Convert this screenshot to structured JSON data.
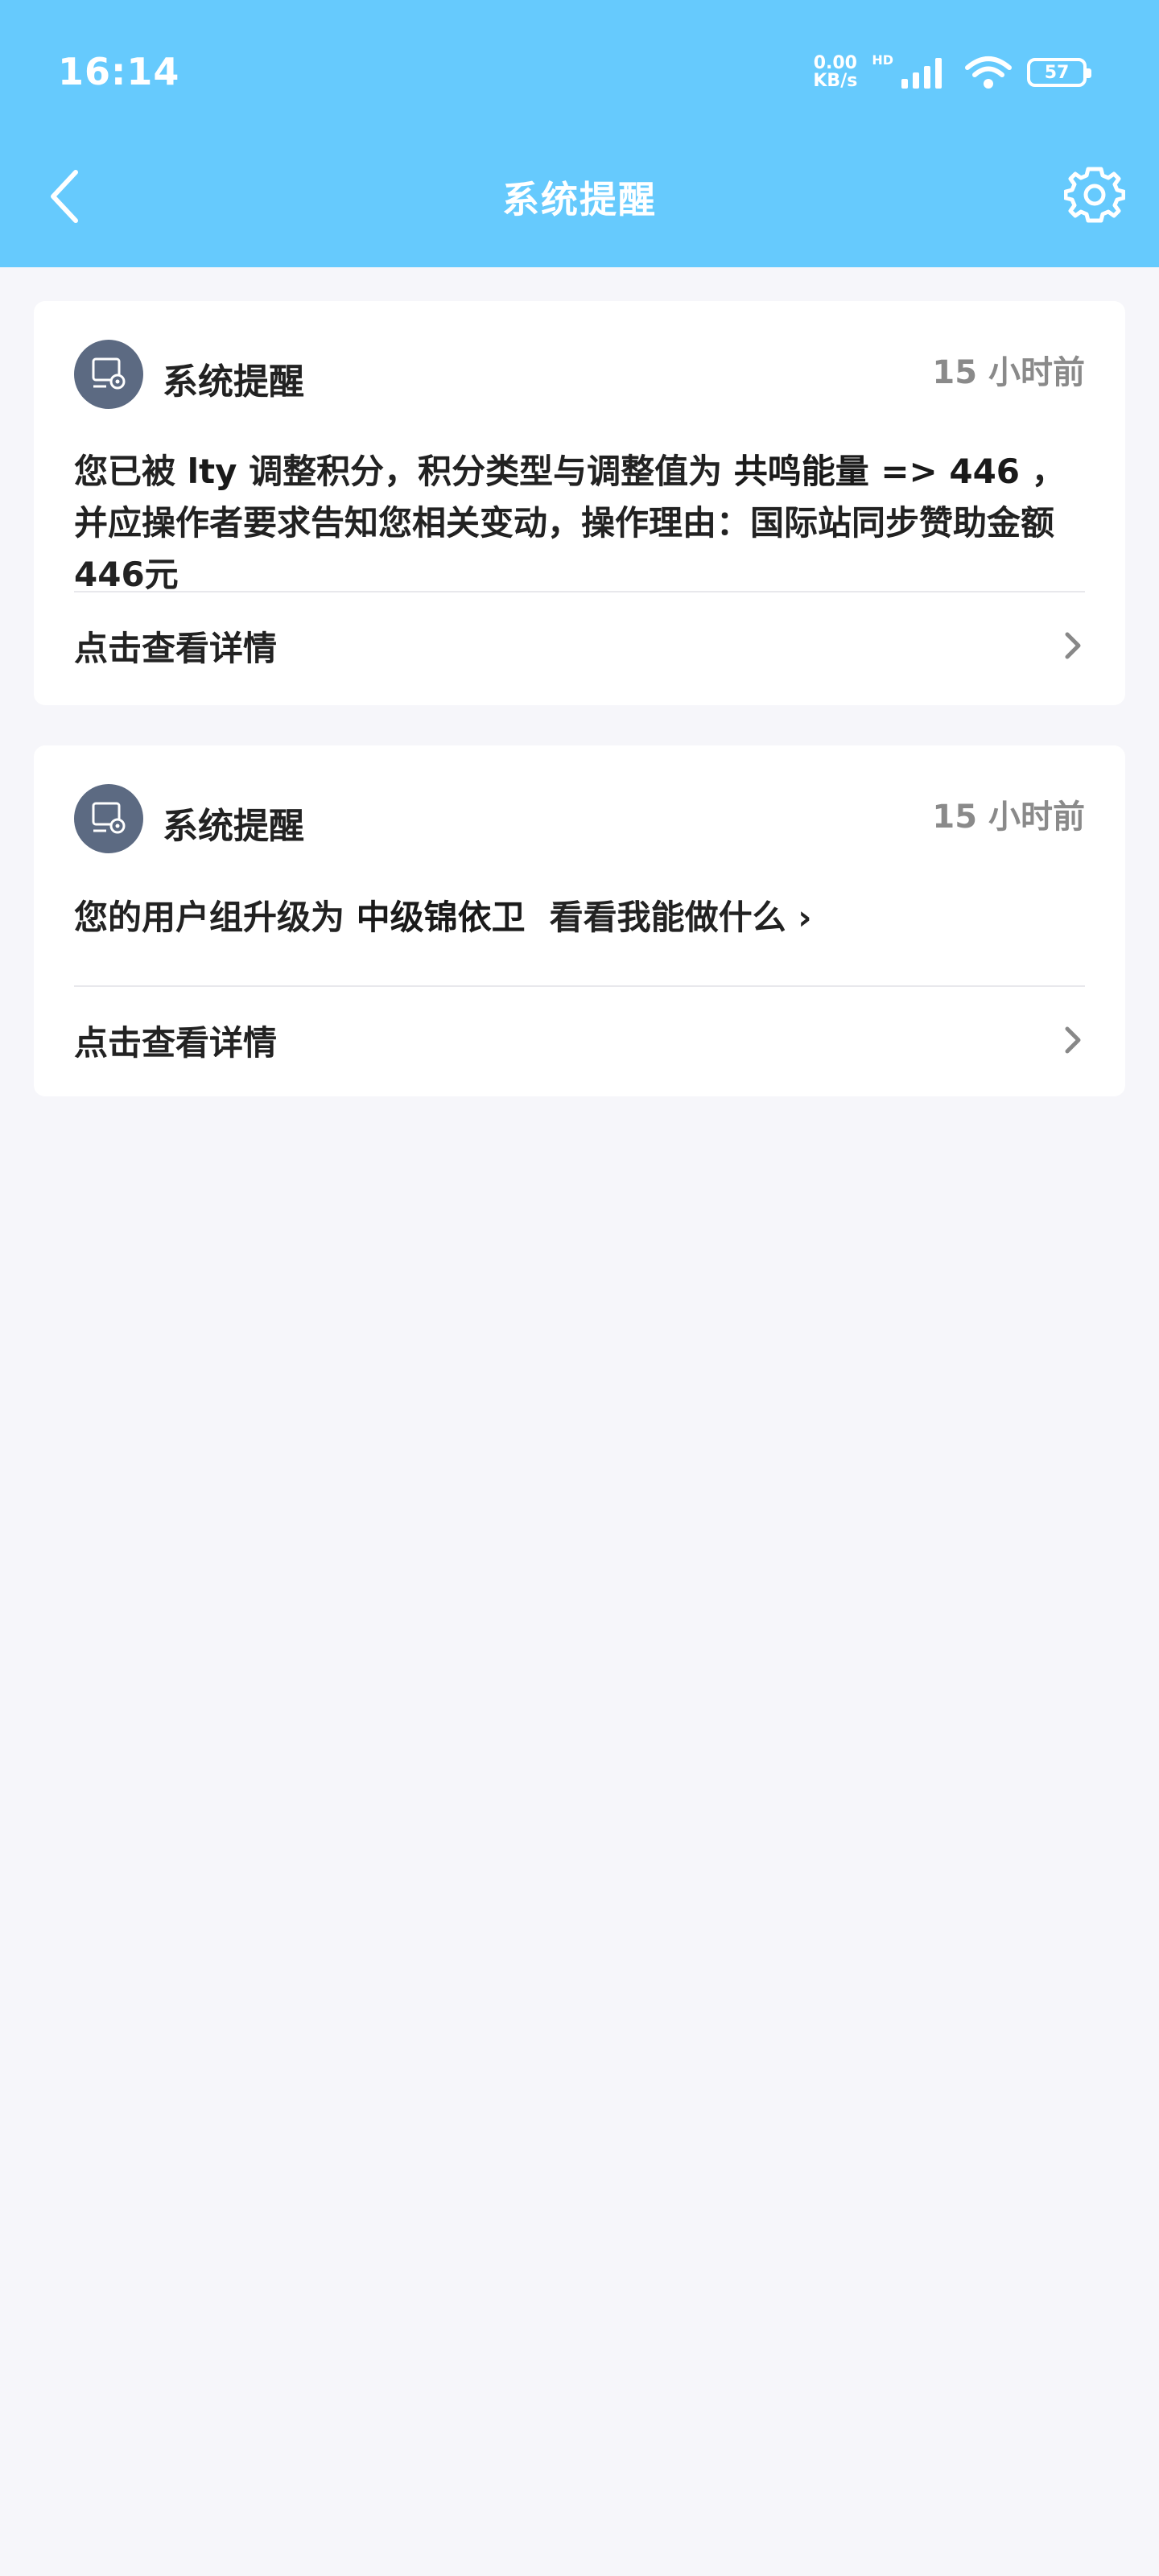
{
  "status_bar": {
    "time": "16:14",
    "net_speed_value": "0.00",
    "net_speed_unit": "KB/s",
    "hd_label": "HD",
    "battery_level": "57"
  },
  "nav": {
    "title": "系统提醒"
  },
  "notifications": [
    {
      "title": "系统提醒",
      "time": "15 小时前",
      "body_parts": {
        "p1": "您已被 ",
        "p2": "lty",
        "p3": " 调整积分，积分类型与调整值为 ",
        "p4": "共鸣能量 => 446",
        "p5": " ，并应操作者要求告知您相关变动，操作理由：国际站同步赞助金额446元"
      },
      "detail_label": "点击查看详情"
    },
    {
      "title": "系统提醒",
      "time": "15 小时前",
      "body_parts": {
        "p1": "您的用户组升级为 ",
        "p2": "中级锦依卫",
        "p3": "看看我能做什么 ›"
      },
      "detail_label": "点击查看详情"
    }
  ]
}
